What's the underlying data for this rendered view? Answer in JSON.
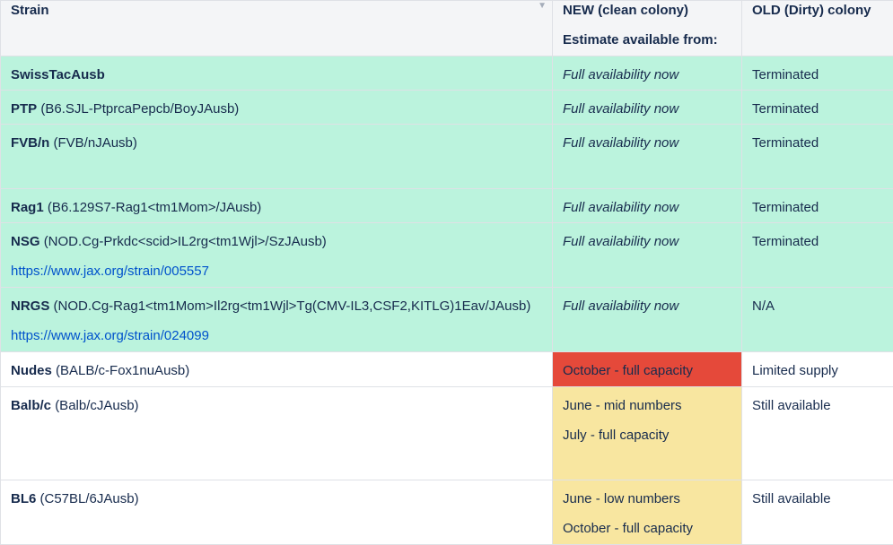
{
  "header": {
    "col1": "Strain",
    "col2_line1": "NEW (clean colony)",
    "col2_line2": "Estimate available from:",
    "col3": "OLD (Dirty) colony"
  },
  "colors": {
    "green": "#bbf3dd",
    "red": "#e5493a",
    "yellow": "#f8e6a0",
    "link": "#0052cc"
  },
  "rows": [
    {
      "name": "SwissTacAusb",
      "detail": "",
      "link": "",
      "new1": "Full availability now",
      "new2": "",
      "old": "Terminated"
    },
    {
      "name": "PTP",
      "detail": "(B6.SJL-PtprcaPepcb/BoyJAusb)",
      "link": "",
      "new1": "Full availability now",
      "new2": "",
      "old": "Terminated"
    },
    {
      "name": "FVB/n",
      "detail": "(FVB/nJAusb)",
      "link": "",
      "new1": "Full availability now",
      "new2": "",
      "old": "Terminated"
    },
    {
      "name": "Rag1",
      "detail": "(B6.129S7-Rag1<tm1Mom>/JAusb)",
      "link": "",
      "new1": "Full availability now",
      "new2": "",
      "old": "Terminated"
    },
    {
      "name": "NSG",
      "detail": "(NOD.Cg-Prkdc<scid>IL2rg<tm1Wjl>/SzJAusb)",
      "link": "https://www.jax.org/strain/005557",
      "new1": "Full availability now",
      "new2": "",
      "old": "Terminated"
    },
    {
      "name": "NRGS",
      "detail": "(NOD.Cg-Rag1<tm1Mom>Il2rg<tm1Wjl>Tg(CMV-IL3,CSF2,KITLG)1Eav/JAusb)",
      "link": "https://www.jax.org/strain/024099",
      "new1": "Full availability now",
      "new2": "",
      "old": "N/A"
    },
    {
      "name": "Nudes",
      "detail": "(BALB/c-Fox1nuAusb)",
      "link": "",
      "new1": "October - full capacity",
      "new2": "",
      "old": "Limited supply"
    },
    {
      "name": "Balb/c",
      "detail": "(Balb/cJAusb)",
      "link": "",
      "new1": "June - mid numbers",
      "new2": "July - full capacity",
      "old": "Still available"
    },
    {
      "name": "BL6",
      "detail": "(C57BL/6JAusb)",
      "link": "",
      "new1": "June - low numbers",
      "new2": "October - full capacity",
      "old": "Still available"
    }
  ]
}
